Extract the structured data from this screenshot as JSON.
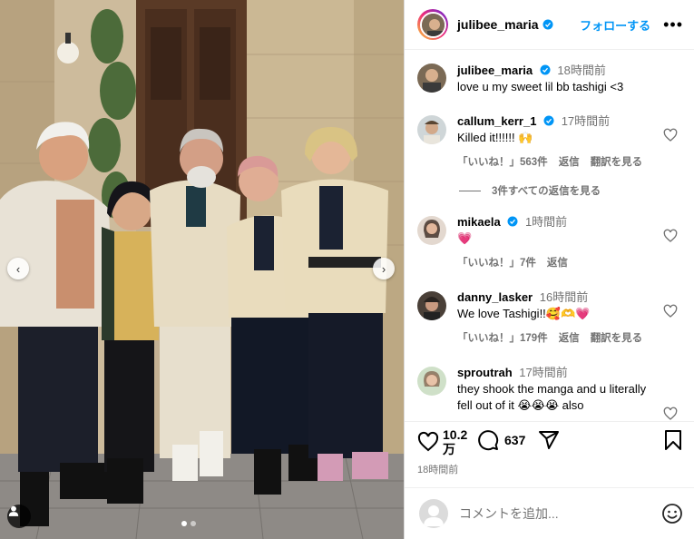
{
  "post": {
    "author": "julibee_maria",
    "follow_label": "フォローする",
    "more_icon": "more-horizontal-icon",
    "verified_color": "#0095f6",
    "caption": {
      "username": "julibee_maria",
      "time": "18時間前",
      "text": "love u my sweet lil bb tashigi <3"
    }
  },
  "comments": [
    {
      "username": "callum_kerr_1",
      "time": "17時間前",
      "text": "Killed it!!!!!! 🙌",
      "likes": "「いいね！」563件",
      "reply": "返信",
      "translate": "翻訳を見る",
      "view_replies": "3件すべての返信を見る"
    },
    {
      "username": "mikaela",
      "time": "1時間前",
      "text": "💗",
      "likes": "「いいね！」7件",
      "reply": "返信"
    },
    {
      "username": "danny_lasker",
      "time": "16時間前",
      "text": "We love Tashigi!!🥰🫶💗",
      "likes": "「いいね！」179件",
      "reply": "返信",
      "translate": "翻訳を見る"
    },
    {
      "username": "sproutrah",
      "time": "17時間前",
      "text": "they shook the manga and u literally fell out of it 😭😭😭 also"
    }
  ],
  "actions": {
    "like_count": "10.2万",
    "comment_count": "637",
    "posted_time": "18時間前"
  },
  "add_comment": {
    "placeholder": "コメントを追加..."
  }
}
